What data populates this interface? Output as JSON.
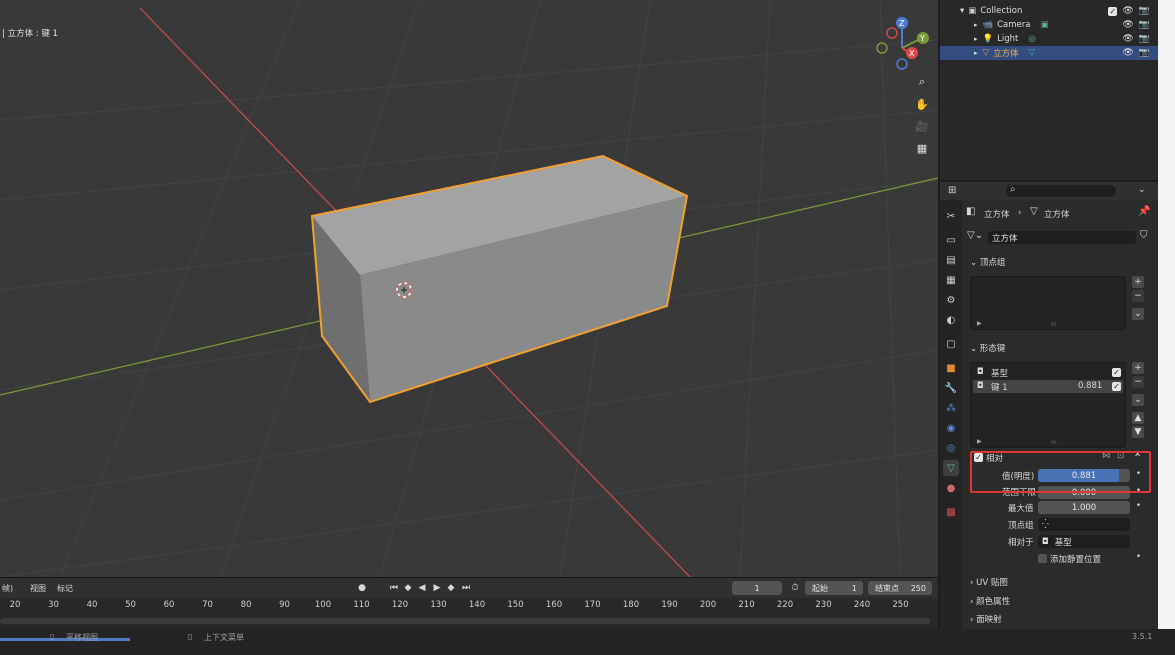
{
  "viewport": {
    "object_label": "| 立方体 : 键 1",
    "axis_gizmo": {
      "z": "Z",
      "y": "Y",
      "x": "X"
    }
  },
  "timeline": {
    "menus": [
      "帧)",
      "视图",
      "标记"
    ],
    "current_frame": "1",
    "start_label": "起始",
    "start_value": "1",
    "end_label": "结束点",
    "end_value": "250",
    "ticks": [
      "20",
      "30",
      "40",
      "50",
      "60",
      "70",
      "80",
      "90",
      "100",
      "110",
      "120",
      "130",
      "140",
      "150",
      "160",
      "170",
      "180",
      "190",
      "200",
      "210",
      "220",
      "230",
      "240",
      "250"
    ]
  },
  "statusbar": {
    "left_hint": "平移视图",
    "mid_hint": "上下文菜单",
    "version": "3.5.1"
  },
  "outliner": {
    "rows": [
      {
        "label": "Collection"
      },
      {
        "label": "Camera"
      },
      {
        "label": "Light"
      },
      {
        "label": "立方体",
        "selected": true
      }
    ]
  },
  "properties": {
    "breadcrumb_object": "立方体",
    "breadcrumb_data": "立方体",
    "data_name": "立方体",
    "vertex_groups_title": "顶点组",
    "shape_keys_title": "形态键",
    "shape_keys": [
      {
        "name": "基型",
        "value": ""
      },
      {
        "name": "键 1",
        "value": "0.881"
      }
    ],
    "relative_label": "相对",
    "value_label": "值(明度)",
    "value": "0.881",
    "value_fraction": 0.881,
    "range_min_label": "范围下限",
    "range_min_value": "0.000",
    "range_max_label": "最大值",
    "range_max_value": "1.000",
    "vertex_group_label": "顶点组",
    "relative_to_label": "相对于",
    "relative_to_value": "基型",
    "add_rest_position": "添加静置位置",
    "uv_maps": "UV 贴图",
    "color_attributes": "颜色属性",
    "face_maps": "面映射"
  },
  "colors": {
    "selection_orange": "#f0a030",
    "highlight_red": "#e03535",
    "value_blue": "#4772b3",
    "x_axis": "#c84b4b",
    "y_axis": "#7a9a3a"
  }
}
